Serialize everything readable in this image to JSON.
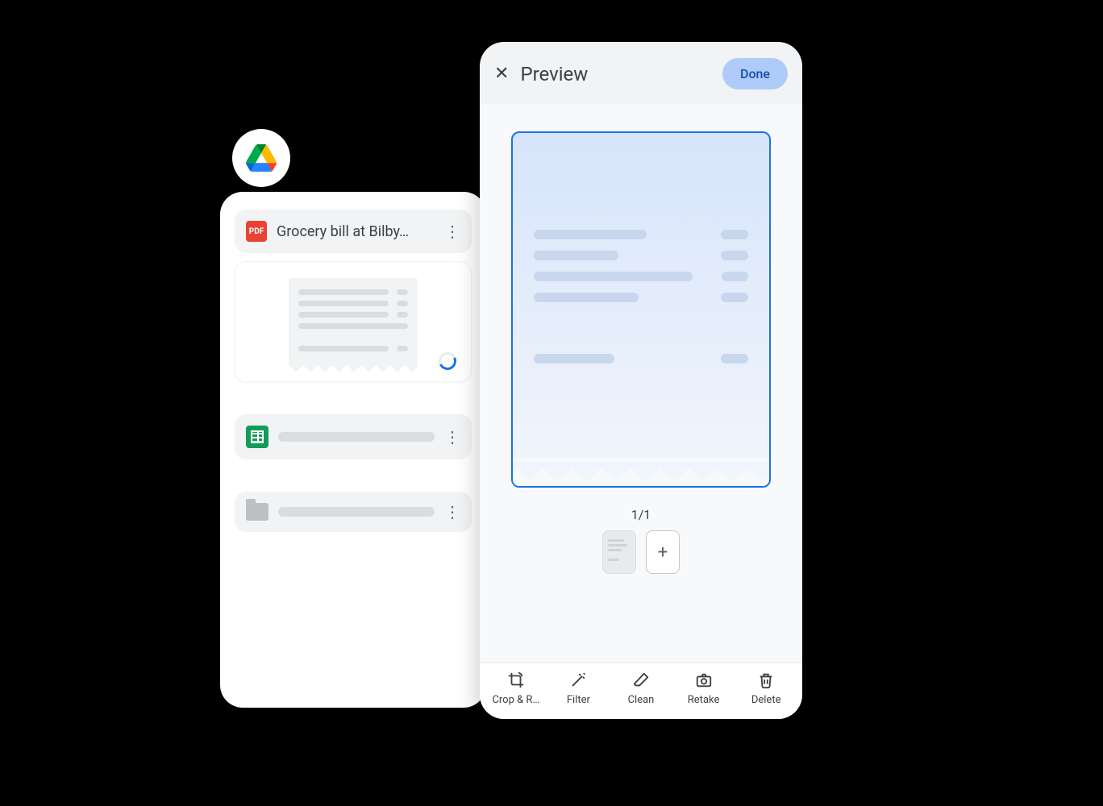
{
  "drive": {
    "files": [
      {
        "type": "pdf",
        "name": "Grocery bill at Bilby…"
      },
      {
        "type": "sheet",
        "name": ""
      },
      {
        "type": "folder",
        "name": ""
      }
    ],
    "pdf_badge": "PDF"
  },
  "preview": {
    "title": "Preview",
    "done": "Done",
    "page_indicator": "1/1",
    "tools": {
      "crop": "Crop & R…",
      "filter": "Filter",
      "clean": "Clean",
      "retake": "Retake",
      "delete": "Delete"
    }
  }
}
